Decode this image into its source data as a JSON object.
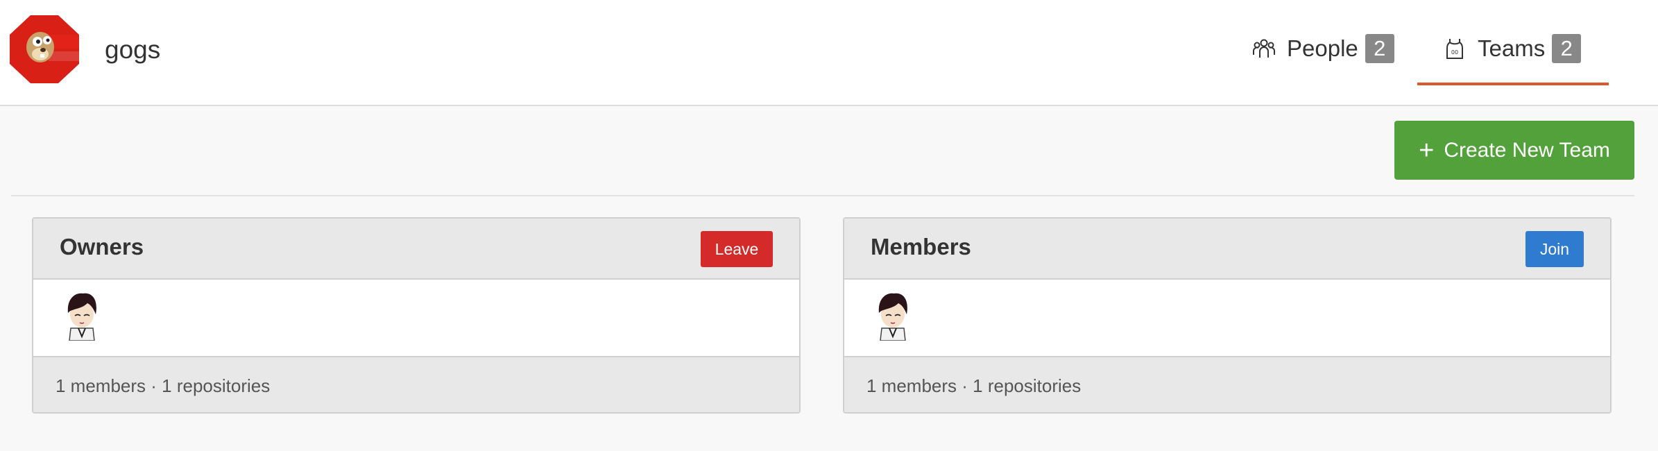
{
  "org": {
    "name": "gogs",
    "logo_icon": "gogs-logo-icon"
  },
  "nav": {
    "items": [
      {
        "label": "People",
        "count": "2",
        "icon": "people-icon"
      },
      {
        "label": "Teams",
        "count": "2",
        "icon": "teams-icon",
        "active": true
      }
    ],
    "active_color": "#d9592c"
  },
  "actions": {
    "create_label": "Create New Team",
    "create_color": "#53a13a"
  },
  "teams": [
    {
      "name": "Owners",
      "action_label": "Leave",
      "action_color": "#d52a2a",
      "summary": "1 members · 1 repositories"
    },
    {
      "name": "Members",
      "action_label": "Join",
      "action_color": "#2f7bd0",
      "summary": "1 members · 1 repositories"
    }
  ]
}
